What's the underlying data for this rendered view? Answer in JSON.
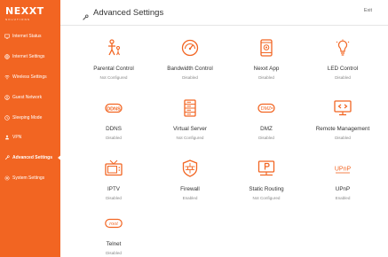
{
  "brand": {
    "name": "NEXXT",
    "tagline": "SOLUTIONS",
    "accent": "#f26522"
  },
  "sidebar": {
    "items": [
      {
        "label": "Internet Status",
        "icon": "monitor-icon"
      },
      {
        "label": "Internet Settings",
        "icon": "globe-icon"
      },
      {
        "label": "Wireless Settings",
        "icon": "wifi-icon"
      },
      {
        "label": "Guest Network",
        "icon": "guest-icon"
      },
      {
        "label": "Sleeping Mode",
        "icon": "clock-icon"
      },
      {
        "label": "VPN",
        "icon": "person-icon"
      },
      {
        "label": "Advanced Settings",
        "icon": "wrench-icon",
        "active": true
      },
      {
        "label": "System Settings",
        "icon": "gear-icon"
      }
    ]
  },
  "header": {
    "title": "Advanced Settings",
    "exit_label": "Exit"
  },
  "features": [
    {
      "name": "Parental Control",
      "status": "Not Configured",
      "icon": "parental-control-icon"
    },
    {
      "name": "Bandwidth Control",
      "status": "Disabled",
      "icon": "bandwidth-gauge-icon"
    },
    {
      "name": "Nexxt App",
      "status": "Disabled",
      "icon": "phone-app-icon"
    },
    {
      "name": "LED Control",
      "status": "Disabled",
      "icon": "lightbulb-icon"
    },
    {
      "name": "DDNS",
      "status": "Disabled",
      "icon": "ddns-icon"
    },
    {
      "name": "Virtual Server",
      "status": "Not Configured",
      "icon": "server-rack-icon"
    },
    {
      "name": "DMZ",
      "status": "Disabled",
      "icon": "dmz-icon"
    },
    {
      "name": "Remote Management",
      "status": "Disabled",
      "icon": "remote-monitor-icon"
    },
    {
      "name": "IPTV",
      "status": "Disabled",
      "icon": "tv-icon"
    },
    {
      "name": "Firewall",
      "status": "Enabled",
      "icon": "shield-icon"
    },
    {
      "name": "Static Routing",
      "status": "Not Configured",
      "icon": "static-routing-icon"
    },
    {
      "name": "UPnP",
      "status": "Enabled",
      "icon": "upnp-icon"
    },
    {
      "name": "Telnet",
      "status": "Disabled",
      "icon": "telnet-root-icon"
    }
  ]
}
